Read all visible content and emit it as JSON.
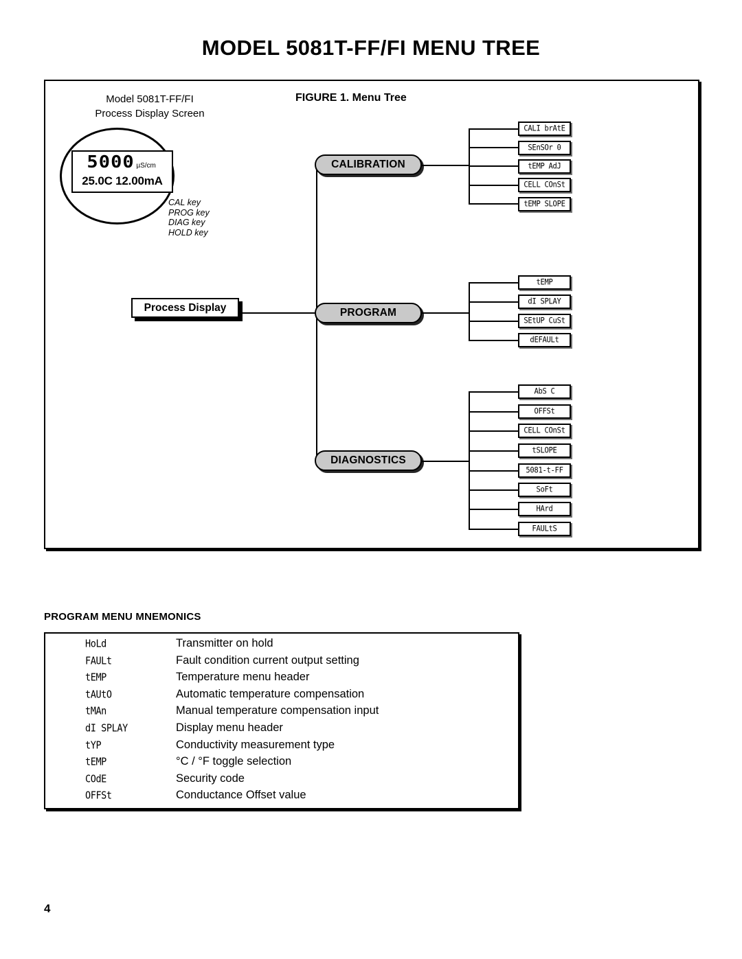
{
  "page": {
    "title": "MODEL 5081T-FF/FI MENU TREE",
    "number": "4"
  },
  "figure": {
    "caption": "FIGURE 1. Menu Tree",
    "device_caption_line1": "Model 5081T-FF/FI",
    "device_caption_line2": "Process Display Screen",
    "lcd": {
      "value": "5000",
      "units": "µS/cm",
      "secondary": "25.0C 12.00mA"
    },
    "keys": [
      "CAL key",
      "PROG key",
      "DIAG key",
      "HOLD key"
    ],
    "root_node": "Process Display",
    "branches": [
      {
        "name": "CALIBRATION",
        "items": [
          "CALI brAtE",
          "SEnSOr 0",
          "tEMP AdJ",
          "CELL COnSt",
          "tEMP SLOPE"
        ]
      },
      {
        "name": "PROGRAM",
        "items": [
          "tEMP",
          "dI SPLAY",
          "SEtUP CuSt",
          "dEFAULt"
        ]
      },
      {
        "name": "DIAGNOSTICS",
        "items": [
          "AbS C",
          "OFFSt",
          "CELL COnSt",
          "tSLOPE",
          "5081-t-FF",
          "SoFt",
          "HArd",
          "FAULtS"
        ]
      }
    ]
  },
  "mnemonics": {
    "heading": "PROGRAM MENU MNEMONICS",
    "rows": [
      {
        "code": "HoLd",
        "desc": "Transmitter on hold"
      },
      {
        "code": "FAULt",
        "desc": "Fault condition current output setting"
      },
      {
        "code": "tEMP",
        "desc": "Temperature menu header"
      },
      {
        "code": "tAUtO",
        "desc": "Automatic temperature compensation"
      },
      {
        "code": "tMAn",
        "desc": "Manual temperature compensation input"
      },
      {
        "code": "dI SPLAY",
        "desc": "Display menu header"
      },
      {
        "code": "tYP",
        "desc": "Conductivity measurement type"
      },
      {
        "code": "tEMP",
        "desc": "°C / °F toggle selection"
      },
      {
        "code": "COdE",
        "desc": "Security code"
      },
      {
        "code": "OFFSt",
        "desc": "Conductance Offset value"
      }
    ]
  },
  "colors": {
    "pill_fill": "#c9c9c9",
    "stroke": "#000000",
    "page_bg": "#ffffff"
  }
}
